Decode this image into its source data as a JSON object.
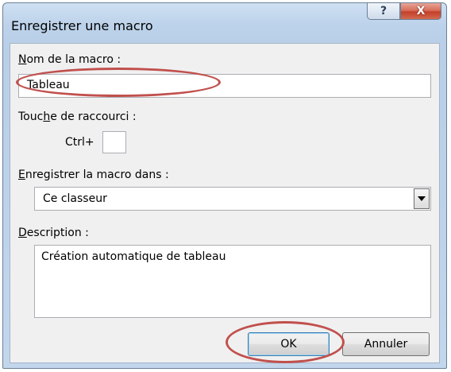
{
  "window": {
    "title": "Enregistrer une macro",
    "help_glyph": "?",
    "close_glyph": "X"
  },
  "form": {
    "macro_name": {
      "label_key": "N",
      "label_rest": "om de la macro :",
      "value": "Tableau"
    },
    "shortcut": {
      "label_pre": "Touc",
      "label_key": "h",
      "label_post": "e de raccourci :",
      "prefix": "Ctrl+",
      "value": ""
    },
    "store_in": {
      "label_key": "E",
      "label_rest": "nregistrer la macro dans :",
      "selected": "Ce classeur"
    },
    "description": {
      "label_key": "D",
      "label_rest": "escription :",
      "value": "Création automatique de tableau"
    }
  },
  "buttons": {
    "ok": "OK",
    "cancel": "Annuler"
  },
  "annotations": {
    "highlight_color": "#c0504d"
  }
}
